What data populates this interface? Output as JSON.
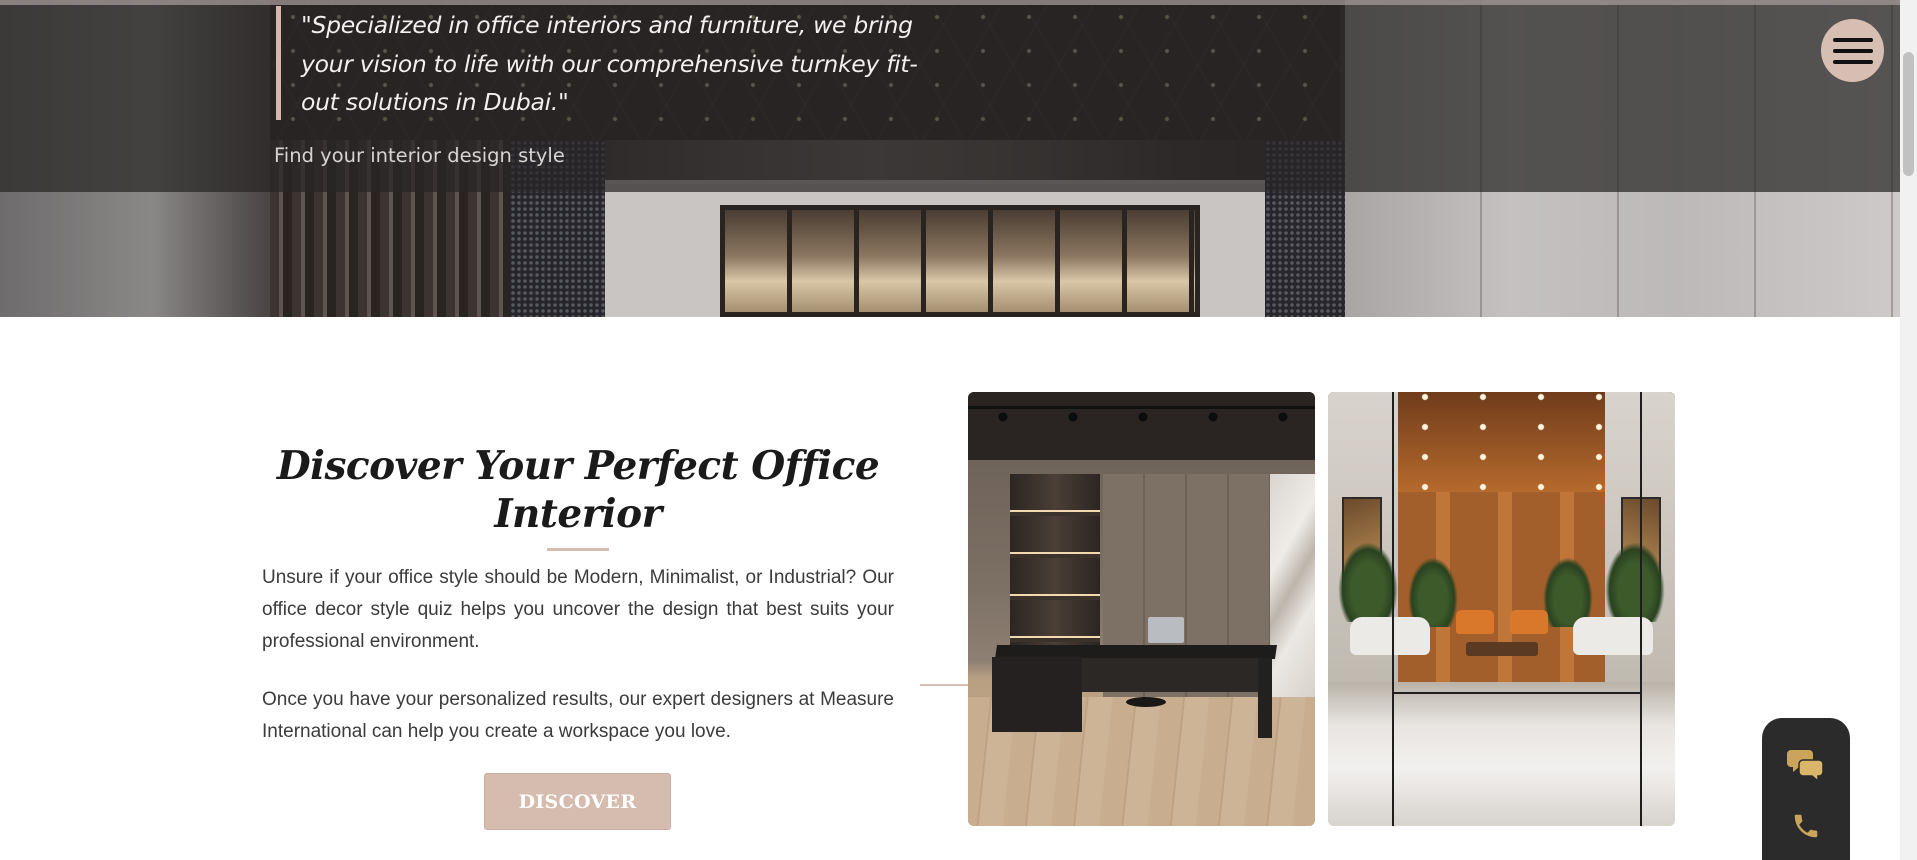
{
  "hero": {
    "quote": "\"Specialized in office interiors and furniture, we bring your vision to life with our comprehensive turnkey fit-out solutions in Dubai.\"",
    "subtitle": "Find your interior design style"
  },
  "nav": {
    "menu_icon": "hamburger-menu-icon"
  },
  "discover": {
    "title": "Discover Your Perfect Office Interior",
    "paragraph_1": "Unsure if your office style should be Modern, Minimalist, or Industrial? Our office decor style quiz helps you uncover the design that best suits your professional environment.",
    "paragraph_2": "Once you have your personalized results, our expert designers at Measure International can help you create a workspace you love.",
    "button_label": "DISCOVER"
  },
  "images": [
    {
      "name": "office-interior-image"
    },
    {
      "name": "lounge-interior-image"
    }
  ],
  "contact_widget": {
    "items": [
      {
        "icon": "chat-bubbles-icon"
      },
      {
        "icon": "phone-icon"
      }
    ]
  },
  "colors": {
    "accent": "#d6bcae",
    "overlay": "#282626",
    "text": "#3b3b3b",
    "widget_bg": "#2b2b2b",
    "icon_gold": "#c9a45a"
  }
}
